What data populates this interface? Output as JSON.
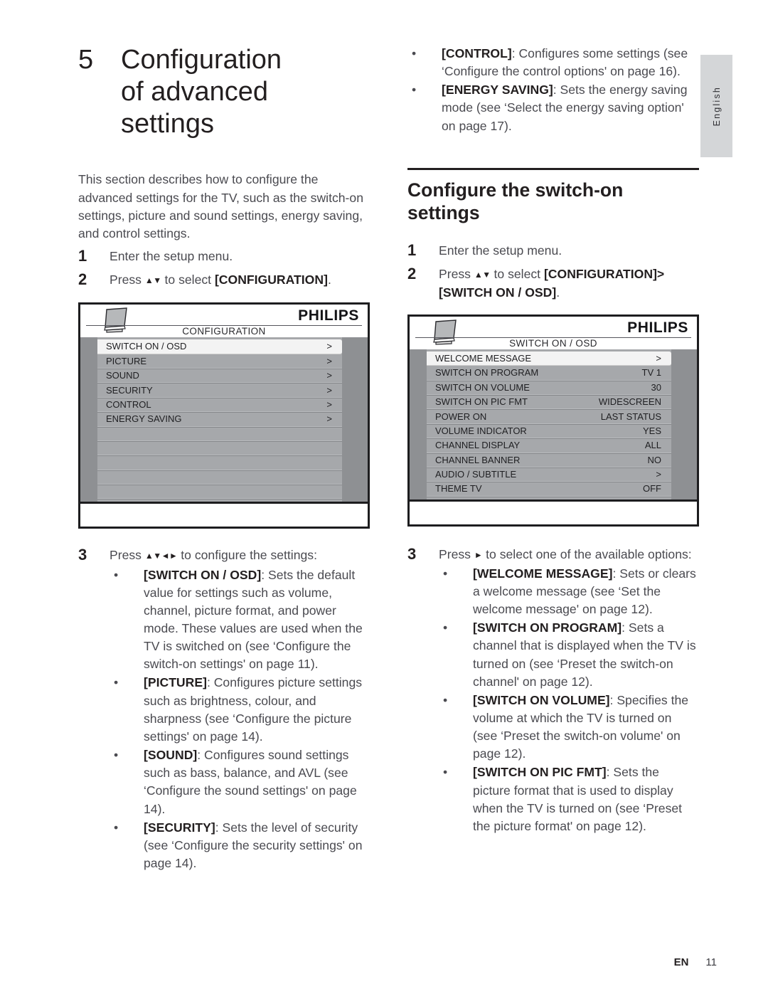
{
  "language_tab": {
    "label": "English"
  },
  "chapter": {
    "number": "5",
    "title_line1": "Configuration",
    "title_line2": "of advanced",
    "title_line3": "settings"
  },
  "left_column": {
    "intro": "This section describes how to configure the advanced settings for the TV, such as the switch-on settings, picture and sound settings, energy saving, and control settings.",
    "steps": [
      {
        "num": "1",
        "text": "Enter the setup menu."
      },
      {
        "num": "2",
        "text_pre": "Press ",
        "arrows": "▲▼",
        "text_mid": " to select ",
        "bold": "[CONFIGURATION]",
        "text_post": "."
      }
    ],
    "step3": {
      "num": "3",
      "text_pre": "Press ",
      "arrows": "▲▼◄►",
      "text_post": " to configure the settings:"
    },
    "bullets": [
      {
        "dot": "•",
        "bold": "[SWITCH ON / OSD]",
        "text": ": Sets the default value for settings such as volume, channel, picture format, and power mode. These values are used when the TV is switched on (see ‘Configure the switch-on settings' on page 11)."
      },
      {
        "dot": "•",
        "bold": "[PICTURE]",
        "text": ": Configures picture settings such as brightness, colour, and sharpness (see ‘Configure the picture settings' on page 14)."
      },
      {
        "dot": "•",
        "bold": "[SOUND]",
        "text": ": Configures sound settings such as bass, balance, and AVL (see ‘Configure the sound settings' on page 14)."
      },
      {
        "dot": "•",
        "bold": "[SECURITY]",
        "text": ": Sets the level of security (see ‘Configure the security settings' on page 14)."
      }
    ]
  },
  "right_column": {
    "top_bullets": [
      {
        "dot": "•",
        "bold": "[CONTROL]",
        "text": ": Configures some settings (see ‘Configure the control options' on page 16)."
      },
      {
        "dot": "•",
        "bold": "[ENERGY SAVING]",
        "text": ": Sets the energy saving mode (see ‘Select the energy saving option' on page 17)."
      }
    ],
    "section_heading": "Configure the switch-on settings",
    "steps": [
      {
        "num": "1",
        "text": "Enter the setup menu."
      },
      {
        "num": "2",
        "text_pre": "Press ",
        "arrows": "▲▼",
        "text_mid": " to select ",
        "bold": "[CONFIGURATION]>[SWITCH ON / OSD]",
        "text_post": "."
      }
    ],
    "step3": {
      "num": "3",
      "text_pre": "Press ",
      "arrows": "►",
      "text_post": " to select one of the available options:"
    },
    "bullets": [
      {
        "dot": "•",
        "bold": "[WELCOME MESSAGE]",
        "text": ": Sets or clears a welcome message (see ‘Set the welcome message' on page 12)."
      },
      {
        "dot": "•",
        "bold": "[SWITCH ON PROGRAM]",
        "text": ": Sets a channel that is displayed when the TV is turned on (see ‘Preset the switch-on channel' on page 12)."
      },
      {
        "dot": "•",
        "bold": "[SWITCH ON VOLUME]",
        "text": ": Specifies the volume at which the TV is turned on (see ‘Preset the switch-on volume' on page 12)."
      },
      {
        "dot": "•",
        "bold": "[SWITCH ON PIC FMT]",
        "text": ": Sets the picture format that is used to display when the TV is turned on (see ‘Preset the picture format' on page 12)."
      }
    ]
  },
  "osd_menu_configuration": {
    "brand": "PHILIPS",
    "title": "CONFIGURATION",
    "rows": [
      {
        "label": "SWITCH ON / OSD",
        "value": ">",
        "selected": true
      },
      {
        "label": "PICTURE",
        "value": ">",
        "selected": false
      },
      {
        "label": "SOUND",
        "value": ">",
        "selected": false
      },
      {
        "label": "SECURITY",
        "value": ">",
        "selected": false
      },
      {
        "label": "CONTROL",
        "value": ">",
        "selected": false
      },
      {
        "label": "ENERGY SAVING",
        "value": ">",
        "selected": false
      },
      {
        "label": "",
        "value": "",
        "selected": false
      },
      {
        "label": "",
        "value": "",
        "selected": false
      },
      {
        "label": "",
        "value": "",
        "selected": false
      },
      {
        "label": "",
        "value": "",
        "selected": false
      },
      {
        "label": "",
        "value": "",
        "selected": false
      }
    ]
  },
  "osd_menu_switch_on": {
    "brand": "PHILIPS",
    "title": "SWITCH ON / OSD",
    "rows": [
      {
        "label": "WELCOME MESSAGE",
        "value": ">",
        "selected": true
      },
      {
        "label": "SWITCH ON PROGRAM",
        "value": "TV 1",
        "selected": false
      },
      {
        "label": "SWITCH ON VOLUME",
        "value": "30",
        "selected": false
      },
      {
        "label": "SWITCH ON PIC FMT",
        "value": "WIDESCREEN",
        "selected": false
      },
      {
        "label": "POWER ON",
        "value": "LAST STATUS",
        "selected": false
      },
      {
        "label": "VOLUME INDICATOR",
        "value": "YES",
        "selected": false
      },
      {
        "label": "CHANNEL DISPLAY",
        "value": "ALL",
        "selected": false
      },
      {
        "label": "CHANNEL BANNER",
        "value": "NO",
        "selected": false
      },
      {
        "label": "AUDIO / SUBTITLE",
        "value": ">",
        "selected": false
      },
      {
        "label": "THEME TV",
        "value": "OFF",
        "selected": false
      }
    ]
  },
  "footer": {
    "language_code": "EN",
    "page_number": "11"
  },
  "colors": {
    "ink": "#231f20",
    "body_text": "#4a4a50",
    "osd_panel": "#a6a8ab",
    "osd_rail": "#8e9093",
    "osd_selected": "#f3f3f3",
    "lang_tab_bg": "#d4d6d8"
  }
}
